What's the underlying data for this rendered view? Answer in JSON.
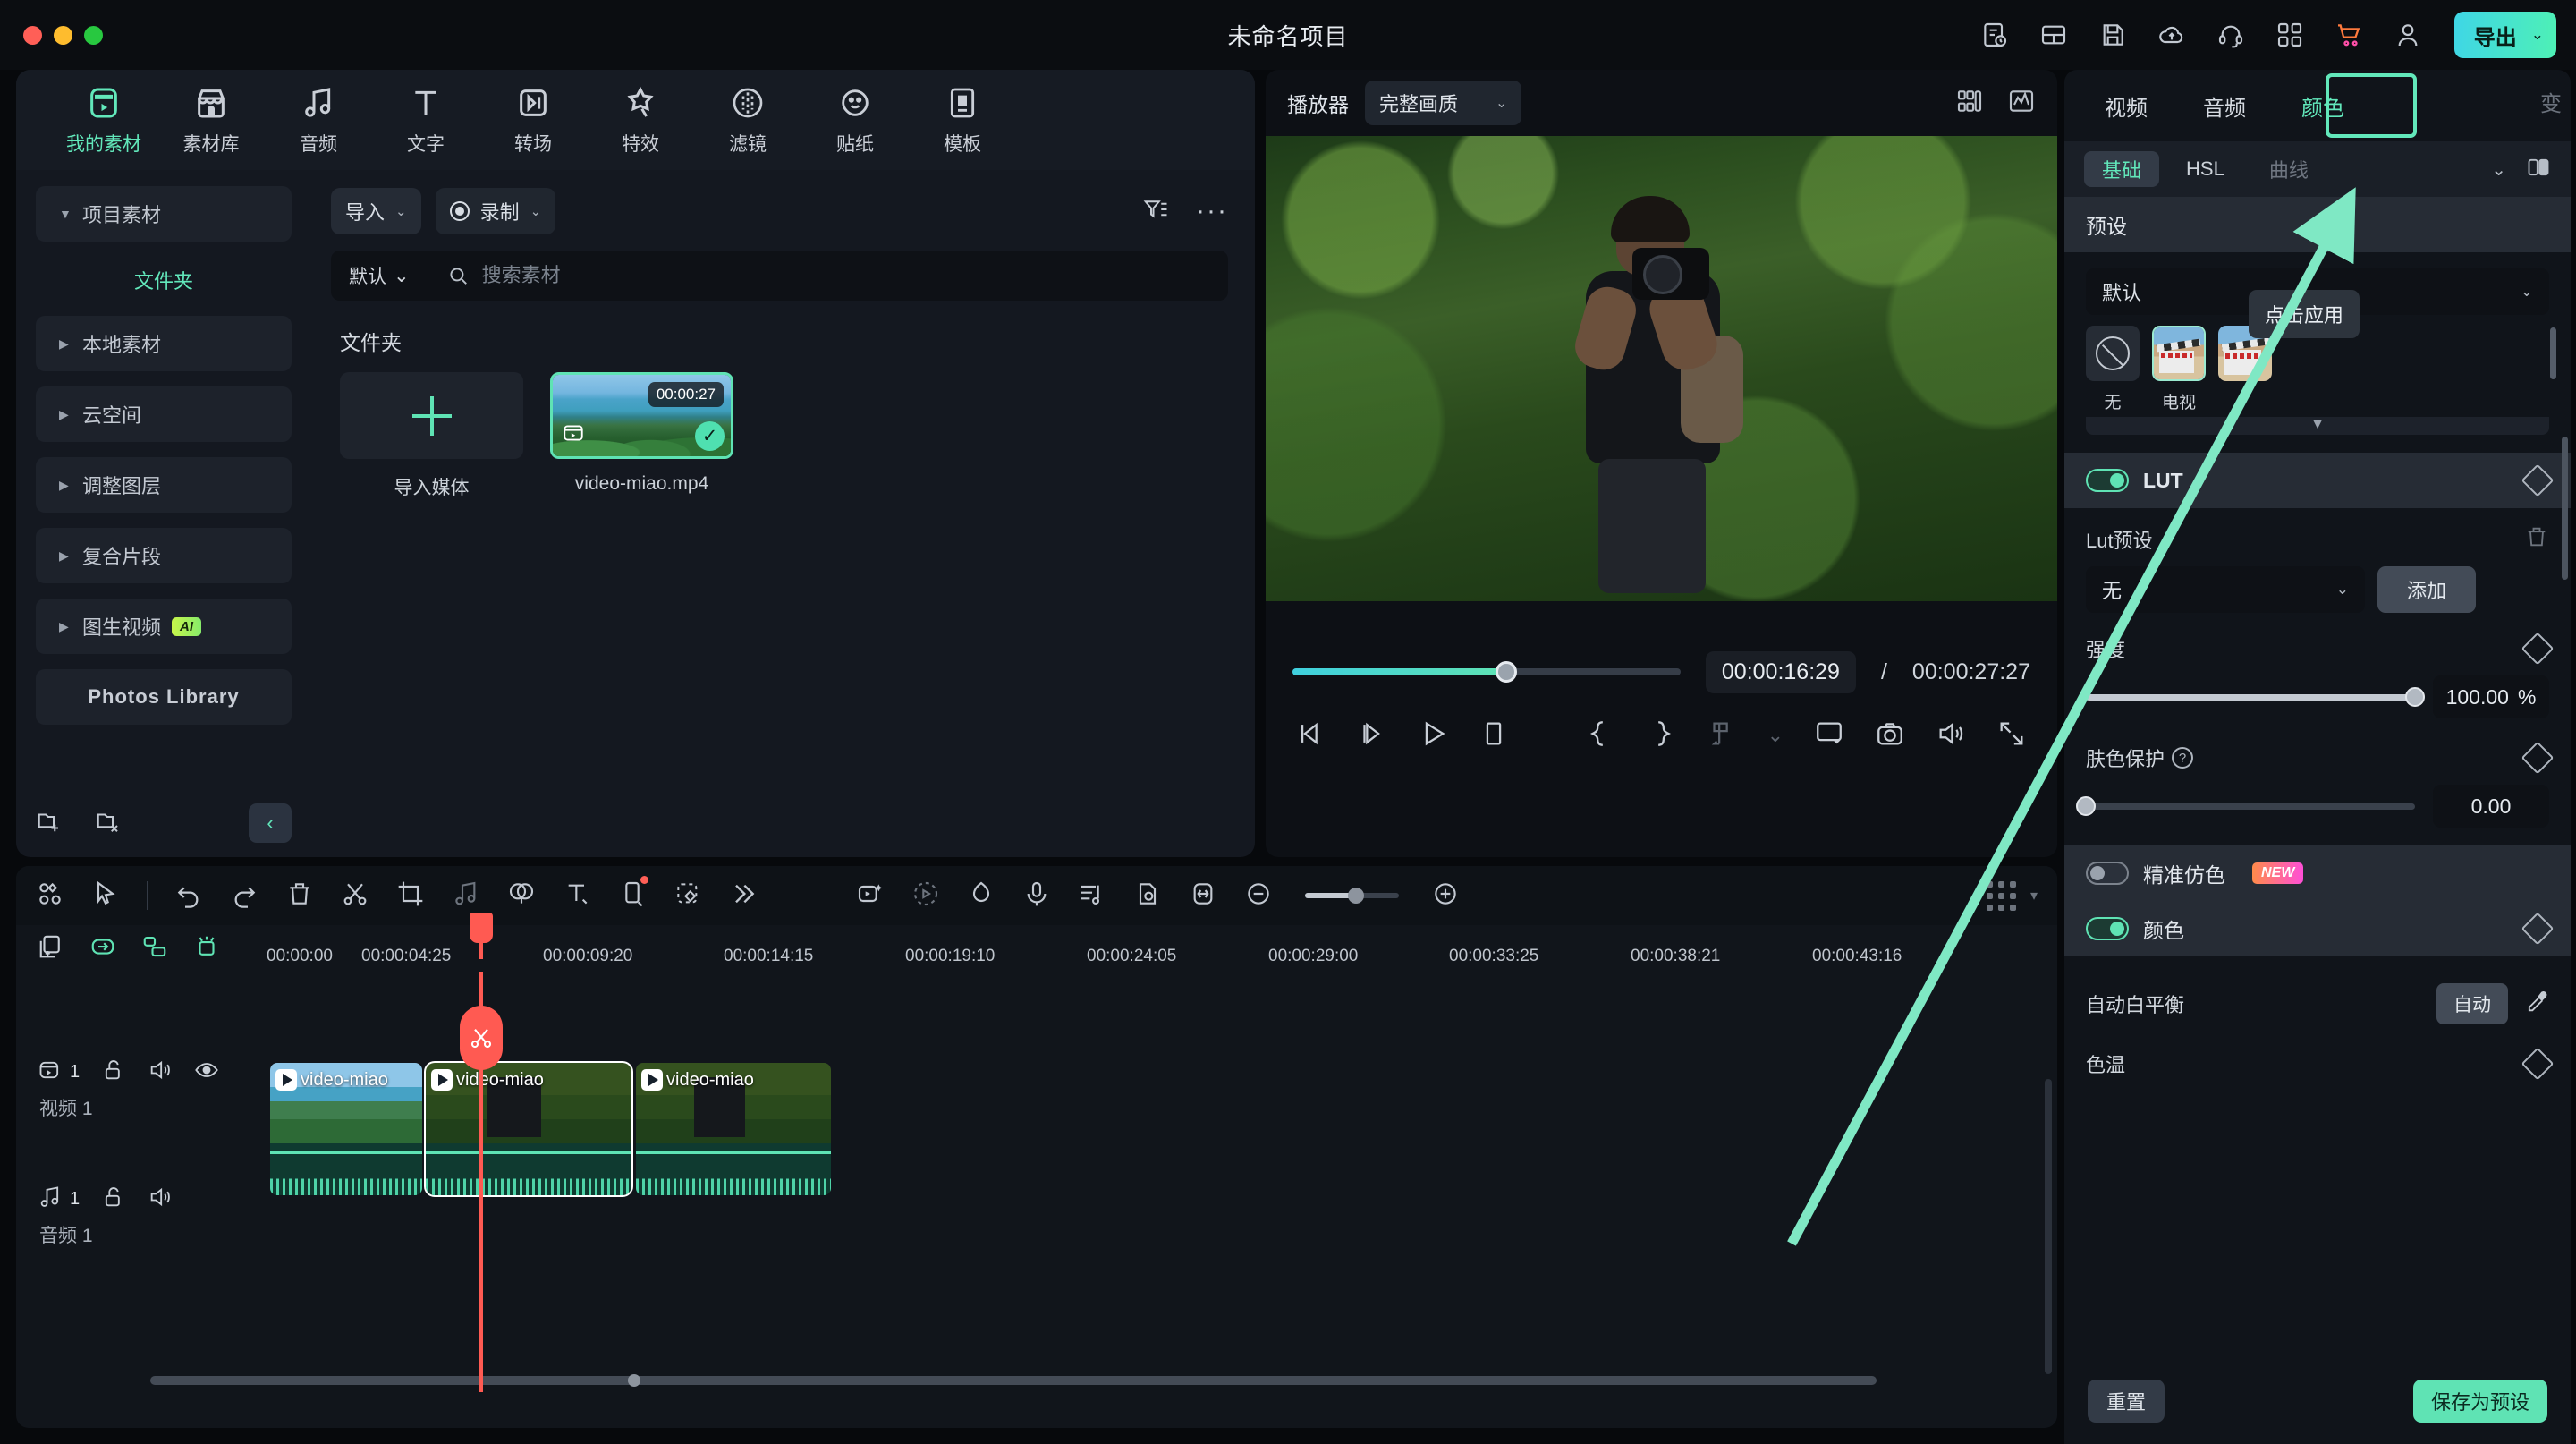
{
  "titlebar": {
    "project_title": "未命名项目",
    "export_label": "导出",
    "export_chevron": "⌄",
    "icons": [
      "task-list-icon",
      "layout-icon",
      "save-icon",
      "cloud-upload-icon",
      "headset-icon",
      "apps-grid-icon",
      "cart-icon",
      "user-icon"
    ]
  },
  "media_panel": {
    "nav_tabs": [
      {
        "label": "我的素材",
        "icon": "my-media-icon",
        "active": true
      },
      {
        "label": "素材库",
        "icon": "stock-library-icon",
        "active": false
      },
      {
        "label": "音频",
        "icon": "audio-icon",
        "active": false
      },
      {
        "label": "文字",
        "icon": "text-icon",
        "active": false
      },
      {
        "label": "转场",
        "icon": "transition-icon",
        "active": false
      },
      {
        "label": "特效",
        "icon": "effects-icon",
        "active": false
      },
      {
        "label": "滤镜",
        "icon": "filter-icon",
        "active": false
      },
      {
        "label": "贴纸",
        "icon": "sticker-icon",
        "active": false
      },
      {
        "label": "模板",
        "icon": "template-icon",
        "active": false
      }
    ],
    "sidebar": {
      "items": [
        {
          "label": "项目素材",
          "expanded": true
        },
        {
          "label": "文件夹",
          "selected": true
        },
        {
          "label": "本地素材",
          "expanded": false
        },
        {
          "label": "云空间",
          "expanded": false
        },
        {
          "label": "调整图层",
          "expanded": false
        },
        {
          "label": "复合片段",
          "expanded": false
        },
        {
          "label": "图生视频",
          "badge": "AI",
          "expanded": false
        },
        {
          "label": "Photos Library"
        }
      ],
      "footer_icons": [
        "new-folder-icon",
        "delete-folder-icon",
        "collapse-panel-icon"
      ]
    },
    "toolbar": {
      "import_label": "导入",
      "record_label": "录制",
      "chevron": "⌄",
      "filter_icon": "filter-sort-icon",
      "more_icon": "more-options-icon"
    },
    "search": {
      "sort_label": "默认",
      "placeholder": "搜索素材",
      "value": "",
      "search_icon": "search-icon"
    },
    "content": {
      "section_title": "文件夹",
      "import_tile_label": "导入媒体",
      "media": [
        {
          "name": "video-miao.mp4",
          "duration": "00:00:27",
          "selected": true
        }
      ]
    }
  },
  "player": {
    "label": "播放器",
    "quality": "完整画质",
    "quality_chevron": "⌄",
    "header_icons": [
      "split-view-icon",
      "waveform-scope-icon"
    ],
    "current_time": "00:00:16:29",
    "time_separator": "/",
    "total_time": "00:00:27:27",
    "progress_percent": 55,
    "controls": [
      "prev-frame-icon",
      "next-frame-icon",
      "play-icon",
      "stop-icon",
      "mark-in-icon",
      "mark-out-icon",
      "snapshot-marker-icon",
      "marker-chevron-icon",
      "screen-icon",
      "camera-icon",
      "volume-icon",
      "fullscreen-icon"
    ]
  },
  "right_panel": {
    "tabs": [
      {
        "label": "视频",
        "selected": false
      },
      {
        "label": "音频",
        "selected": false
      },
      {
        "label": "颜色",
        "selected": true,
        "highlighted": true
      },
      {
        "label": "变",
        "selected": false,
        "clipped": true
      }
    ],
    "subtabs": [
      {
        "label": "基础",
        "selected": true
      },
      {
        "label": "HSL",
        "selected": false
      },
      {
        "label": "曲线",
        "selected": false,
        "faded": true
      }
    ],
    "subtab_icons": [
      "chevron-down-icon",
      "compare-split-icon"
    ],
    "preset": {
      "section_title": "预设",
      "dropdown_value": "默认",
      "dropdown_chevron": "⌄",
      "items": [
        {
          "label": "无",
          "type": "none"
        },
        {
          "label": "电视",
          "type": "thumb",
          "selected": true
        },
        {
          "label": "",
          "type": "thumb"
        }
      ],
      "tooltip": "点击应用",
      "expand_arrow": "▼"
    },
    "lut": {
      "section_title": "LUT",
      "enabled": true,
      "keyframe_icon": "keyframe-diamond-icon",
      "preset_label": "Lut预设",
      "preset_value": "无",
      "preset_chevron": "⌄",
      "add_label": "添加",
      "delete_icon": "trash-icon",
      "intensity_label": "强度",
      "intensity_value": "100.00",
      "intensity_unit": "%",
      "intensity_percent": 100,
      "skin_label": "肤色保护",
      "skin_help_icon": "help-icon",
      "skin_value": "0.00",
      "skin_percent": 0
    },
    "precise_color": {
      "label": "精准仿色",
      "badge": "NEW",
      "enabled": false
    },
    "color": {
      "section_title": "颜色",
      "enabled": true,
      "keyframe_icon": "keyframe-diamond-icon",
      "wb_label": "自动白平衡",
      "wb_button": "自动",
      "eyedropper_icon": "eyedropper-icon",
      "temp_label": "色温"
    },
    "footer": {
      "reset_label": "重置",
      "save_preset_label": "保存为预设"
    }
  },
  "timeline": {
    "toolbar_icons_left": [
      "grid-view-icon",
      "select-tool-icon",
      "undo-icon",
      "redo-icon",
      "delete-icon",
      "split-icon",
      "crop-icon",
      "audio-detach-icon",
      "color-match-icon",
      "text-icon",
      "mask-icon",
      "keying-icon",
      "more-tools-icon"
    ],
    "toolbar_icons_mid": [
      "auto-reframe-icon",
      "motion-tracking-icon",
      "shape-icon",
      "voiceover-icon",
      "audio-mixer-icon",
      "sticker-track-icon",
      "fit-timeline-icon",
      "zoom-out-icon",
      "zoom-in-icon"
    ],
    "toolbar_icons_right": [
      "render-grid-icon",
      "track-menu-icon"
    ],
    "zoom_percent": 54,
    "track_header_icons": [
      "add-track-icon",
      "link-icon",
      "group-icon",
      "marker-icon"
    ],
    "ruler_ticks": [
      "00:00:00",
      "00:00:04:25",
      "00:00:09:20",
      "00:00:14:15",
      "00:00:19:10",
      "00:00:24:05",
      "00:00:29:00",
      "00:00:33:25",
      "00:00:38:21",
      "00:00:43:16"
    ],
    "tracks": [
      {
        "name": "视频 1",
        "index": "1",
        "type": "video",
        "icons": [
          "video-track-icon",
          "unlock-icon",
          "mute-icon",
          "eye-icon"
        ]
      },
      {
        "name": "音频 1",
        "index": "1",
        "type": "audio",
        "icons": [
          "audio-track-icon",
          "unlock-icon",
          "mute-icon"
        ]
      }
    ],
    "clips": [
      {
        "name": "video-miao",
        "selected": false,
        "style": "beach"
      },
      {
        "name": "video-miao",
        "selected": true,
        "style": "mixed"
      },
      {
        "name": "video-miao",
        "selected": false,
        "style": "forest"
      }
    ],
    "playhead_time": "00:00:16:29",
    "cut_icon": "scissors-icon"
  },
  "annotation": {
    "arrow_color": "#7fe8c4",
    "target": "颜色"
  }
}
